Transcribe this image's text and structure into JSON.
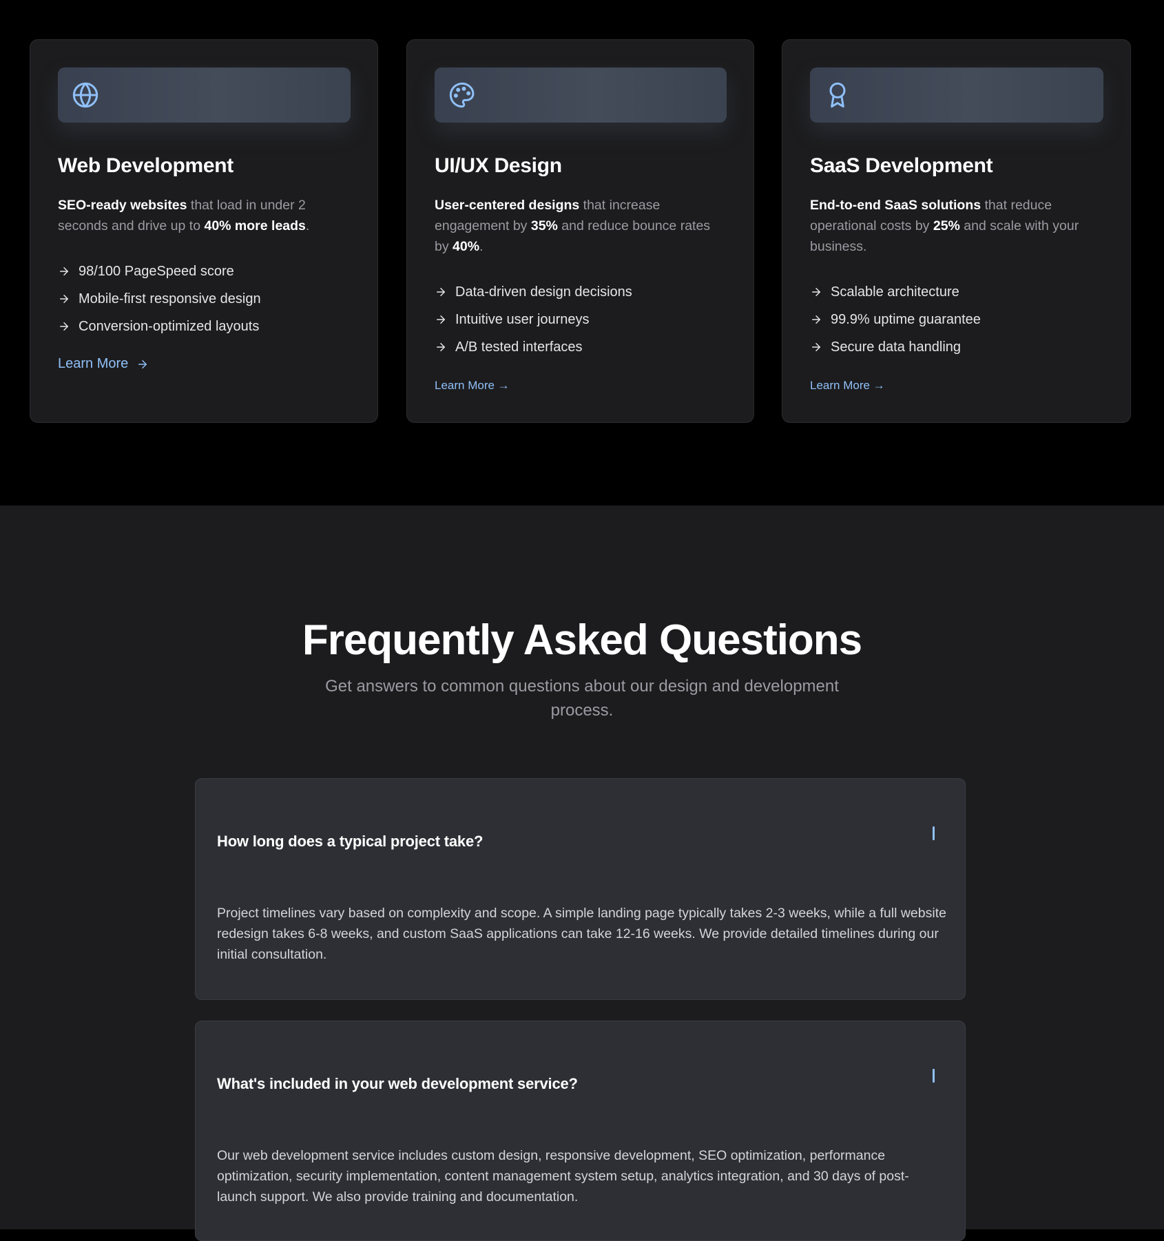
{
  "colors": {
    "accent": "#90c0f8",
    "card_bg": "#1c1c1e",
    "faq_bg": "#1c1c1e",
    "faq_item_bg": "#2d2f34",
    "muted_text": "#9b9ba3"
  },
  "services": [
    {
      "icon": "globe-icon",
      "title": "Web Development",
      "desc_bold1": "SEO-ready websites",
      "desc_text1": " that load in under 2 seconds and drive up to ",
      "desc_bold2": "40% more leads",
      "desc_text2": ".",
      "features": [
        "98/100 PageSpeed score",
        "Mobile-first responsive design",
        "Conversion-optimized layouts"
      ],
      "link": "Learn More"
    },
    {
      "icon": "palette-icon",
      "title": "UI/UX Design",
      "desc_bold1": "User-centered designs",
      "desc_text1": " that increase engagement by ",
      "desc_bold2": "35%",
      "desc_text2": " and reduce bounce rates by ",
      "desc_bold3": "40%",
      "desc_text3": ".",
      "features": [
        "Data-driven design decisions",
        "Intuitive user journeys",
        "A/B tested interfaces"
      ],
      "link": "Learn More →"
    },
    {
      "icon": "award-icon",
      "title": "SaaS Development",
      "desc_bold1": "End-to-end SaaS solutions",
      "desc_text1": " that reduce operational costs by ",
      "desc_bold2": "25%",
      "desc_text2": " and scale with your business.",
      "features": [
        "Scalable architecture",
        "99.9% uptime guarantee",
        "Secure data handling"
      ],
      "link": "Learn More →"
    }
  ],
  "faq": {
    "title": "Frequently Asked Questions",
    "subtitle": "Get answers to common questions about our design and development process.",
    "items": [
      {
        "question": "How long does a typical project take?",
        "answer": "Project timelines vary based on complexity and scope. A simple landing page typically takes 2-3 weeks, while a full website redesign takes 6-8 weeks, and custom SaaS applications can take 12-16 weeks. We provide detailed timelines during our initial consultation."
      },
      {
        "question": "What's included in your web development service?",
        "answer": "Our web development service includes custom design, responsive development, SEO optimization, performance optimization, security implementation, content management system setup, analytics integration, and 30 days of post-launch support. We also provide training and documentation."
      }
    ]
  }
}
